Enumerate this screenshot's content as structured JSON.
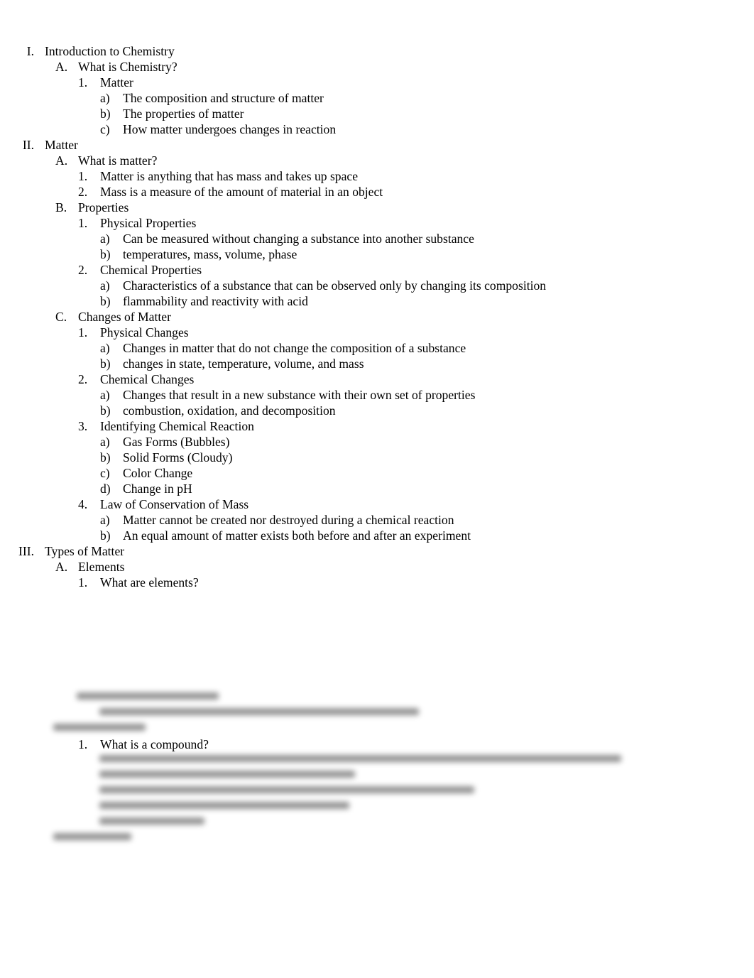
{
  "outline": [
    {
      "level": 1,
      "marker": "I.",
      "text": "Introduction to Chemistry"
    },
    {
      "level": 2,
      "marker": "A.",
      "text": "What is Chemistry?"
    },
    {
      "level": 3,
      "marker": "1.",
      "text": "Matter"
    },
    {
      "level": 4,
      "marker": "a)",
      "text": "The composition and structure of matter"
    },
    {
      "level": 4,
      "marker": "b)",
      "text": "The properties of matter"
    },
    {
      "level": 4,
      "marker": "c)",
      "text": "How matter undergoes changes in reaction"
    },
    {
      "level": 1,
      "marker": "II.",
      "text": "Matter"
    },
    {
      "level": 2,
      "marker": "A.",
      "text": "What is matter?"
    },
    {
      "level": 3,
      "marker": "1.",
      "text": "Matter is anything that has mass and takes up space"
    },
    {
      "level": 3,
      "marker": "2.",
      "text": "Mass is a measure of the amount of material in an object"
    },
    {
      "level": 2,
      "marker": "B.",
      "text": "Properties"
    },
    {
      "level": 3,
      "marker": "1.",
      "text": "Physical Properties"
    },
    {
      "level": 4,
      "marker": "a)",
      "text": "Can be measured without changing a substance into another substance"
    },
    {
      "level": 4,
      "marker": "b)",
      "text": "temperatures, mass, volume, phase"
    },
    {
      "level": 3,
      "marker": "2.",
      "text": "Chemical Properties"
    },
    {
      "level": 4,
      "marker": "a)",
      "text": "Characteristics of a substance that can be observed only by changing its composition"
    },
    {
      "level": 4,
      "marker": "b)",
      "text": "flammability and reactivity with acid"
    },
    {
      "level": 2,
      "marker": "C.",
      "text": "Changes of Matter"
    },
    {
      "level": 3,
      "marker": "1.",
      "text": "Physical Changes"
    },
    {
      "level": 4,
      "marker": "a)",
      "text": "Changes in matter that do not change the composition of a substance"
    },
    {
      "level": 4,
      "marker": "b)",
      "text": "changes in state, temperature, volume, and mass"
    },
    {
      "level": 3,
      "marker": "2.",
      "text": "Chemical Changes"
    },
    {
      "level": 4,
      "marker": "a)",
      "text": "Changes that result in a new substance with their own set of properties"
    },
    {
      "level": 4,
      "marker": "b)",
      "text": "combustion, oxidation, and decomposition"
    },
    {
      "level": 3,
      "marker": "3.",
      "text": "Identifying Chemical Reaction"
    },
    {
      "level": 4,
      "marker": "a)",
      "text": "Gas Forms (Bubbles)"
    },
    {
      "level": 4,
      "marker": "b)",
      "text": "Solid Forms (Cloudy)"
    },
    {
      "level": 4,
      "marker": "c)",
      "text": "Color Change"
    },
    {
      "level": 4,
      "marker": "d)",
      "text": "Change in pH"
    },
    {
      "level": 3,
      "marker": "4.",
      "text": "Law of Conservation of Mass"
    },
    {
      "level": 4,
      "marker": "a)",
      "text": "Matter cannot be created nor destroyed during a chemical reaction"
    },
    {
      "level": 4,
      "marker": "b)",
      "text": "An equal amount of matter exists both before and after an experiment"
    },
    {
      "level": 1,
      "marker": "III.",
      "text": "Types of Matter"
    },
    {
      "level": 2,
      "marker": "A.",
      "text": "Elements"
    },
    {
      "level": 3,
      "marker": "1.",
      "text": "What are elements?"
    }
  ],
  "visible_after_blur": {
    "level": 3,
    "marker": "1.",
    "text": "What is a compound?"
  }
}
